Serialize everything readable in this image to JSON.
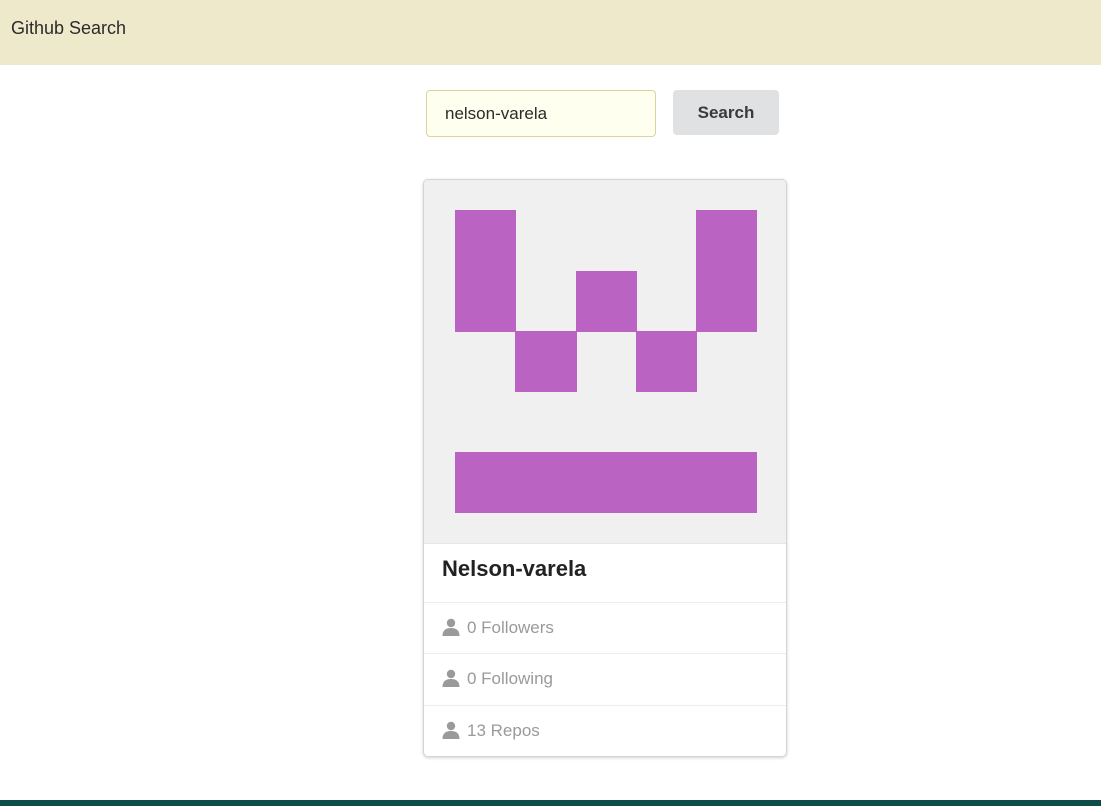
{
  "navbar": {
    "brand": "Github Search"
  },
  "search": {
    "value": "nelson-varela",
    "button_label": "Search"
  },
  "profile": {
    "avatar_color": "#bb63c3",
    "avatar_bg": "#f0f0f0",
    "name": "Nelson-varela",
    "followers": "0 Followers",
    "following": "0 Following",
    "repos": "13 Repos",
    "stat_icon": "user-icon"
  },
  "colors": {
    "navbar": "#efe9cc",
    "footer": "#0f4a4a"
  }
}
